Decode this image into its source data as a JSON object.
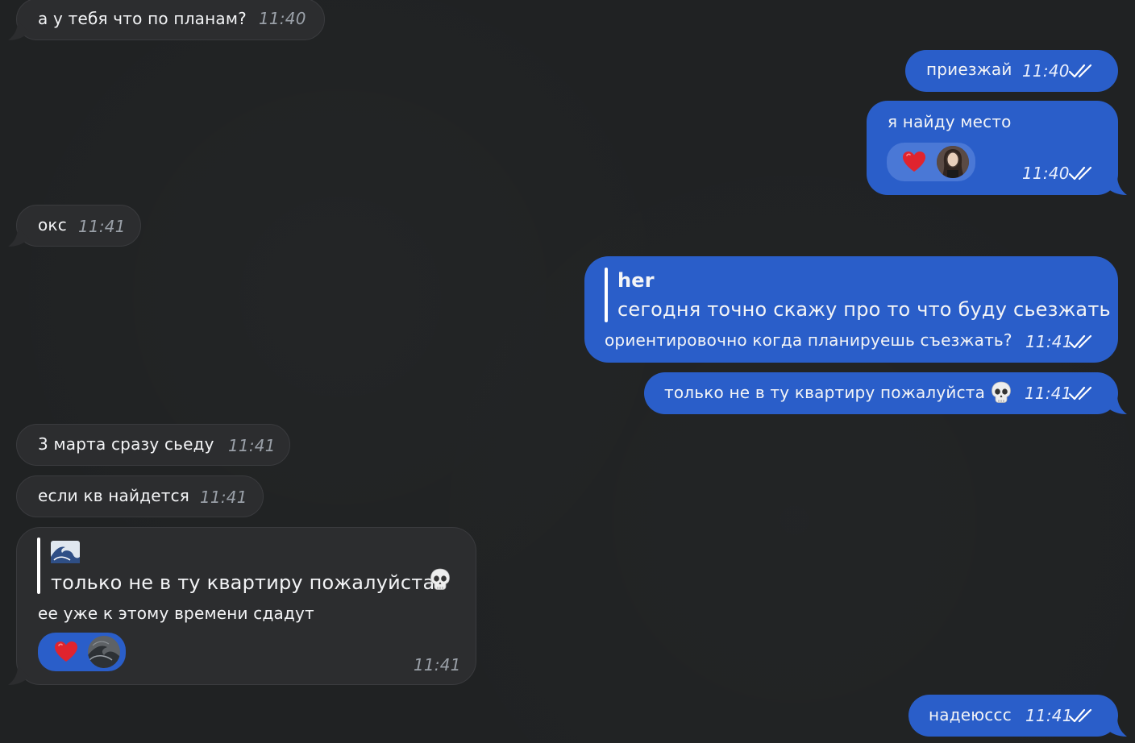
{
  "messages": [
    {
      "id": "m1",
      "direction": "incoming",
      "text": "а у тебя что по планам?",
      "time": "11:40"
    },
    {
      "id": "m2",
      "direction": "outgoing",
      "text": "приезжай",
      "time": "11:40",
      "status": "read"
    },
    {
      "id": "m3",
      "direction": "outgoing",
      "text": "я найду место",
      "time": "11:40",
      "status": "read",
      "reaction": {
        "emoji": "heart-icon",
        "by": "her-avatar"
      }
    },
    {
      "id": "m4",
      "direction": "incoming",
      "text": "окс",
      "time": "11:41"
    },
    {
      "id": "m5",
      "direction": "outgoing",
      "reply": {
        "author": "her",
        "text": "сегодня точно скажу про то что буду сьезжать"
      },
      "text": "ориентировочно когда планируешь съезжать?",
      "time": "11:41",
      "status": "read"
    },
    {
      "id": "m6",
      "direction": "outgoing",
      "text": "только не в ту квартиру пожалуйста",
      "emoji": "skull-icon",
      "time": "11:41",
      "status": "read"
    },
    {
      "id": "m7",
      "direction": "incoming",
      "text": "3 марта сразу сьеду",
      "time": "11:41"
    },
    {
      "id": "m8",
      "direction": "incoming",
      "text": "если кв найдется",
      "time": "11:41"
    },
    {
      "id": "m9",
      "direction": "incoming",
      "reply": {
        "author_icon": "wave-icon",
        "text": "только не в ту квартиру пожалуйста",
        "emoji": "skull-icon"
      },
      "text": "ее уже к этому времени сдадут",
      "time": "11:41",
      "reaction": {
        "emoji": "heart-icon",
        "by": "wave-avatar",
        "color": "#2a5ec9"
      }
    },
    {
      "id": "m10",
      "direction": "outgoing",
      "text": "надеюссс",
      "time": "11:41",
      "status": "read"
    }
  ],
  "colors": {
    "background": "#202223",
    "incoming_bubble": "#2c2d2f",
    "outgoing_bubble": "#2a5ec9",
    "heart": "#e0242e"
  }
}
